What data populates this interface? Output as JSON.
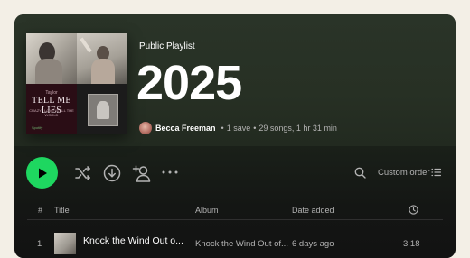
{
  "playlist": {
    "type_label": "Public Playlist",
    "title": "2025",
    "owner": "Becca Freeman",
    "saves": "1 save",
    "stats": "29 songs, 1 hr 31 min",
    "cover_tile_text": {
      "top": "Taylor",
      "main": "TELL ME LIES",
      "sub": "CRAZY · LOVE IS ALL THE WORLD",
      "foot": "Spotify"
    }
  },
  "toolbar": {
    "sort_label": "Custom order",
    "icons": [
      "play-icon",
      "shuffle-icon",
      "download-icon",
      "add-user-icon",
      "more-icon",
      "search-icon",
      "list-icon"
    ]
  },
  "table": {
    "columns": {
      "num": "#",
      "title": "Title",
      "album": "Album",
      "date_added": "Date added",
      "duration_icon": "clock-icon"
    },
    "rows": [
      {
        "num": "1",
        "title": "Knock the Wind Out o...",
        "album": "Knock the Wind Out of...",
        "date_added": "6 days ago",
        "duration": "3:18"
      }
    ]
  },
  "colors": {
    "accent": "#1ed760",
    "header_bg": "#2a3428",
    "page_bg": "#f3efe6",
    "panel_bg": "#121212"
  }
}
